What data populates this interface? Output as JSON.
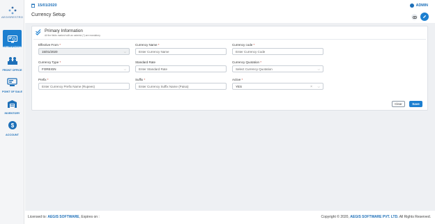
{
  "brand": {
    "name": "AEGISRESTRO"
  },
  "sidebar": {
    "items": [
      {
        "label": "APPLICATION",
        "icon": "application-icon",
        "active": true
      },
      {
        "label": "FRONT OFFICE",
        "icon": "front-office-icon",
        "active": false
      },
      {
        "label": "POINT OF SALE",
        "icon": "point-of-sale-icon",
        "active": false
      },
      {
        "label": "INVENTORY",
        "icon": "inventory-icon",
        "active": false
      },
      {
        "label": "ACCOUNT",
        "icon": "account-icon",
        "active": false
      }
    ]
  },
  "header": {
    "date": "15/01/2020",
    "user": "ADMIN",
    "page_title": "Currency Setup"
  },
  "form": {
    "section_title": "Primary Information",
    "section_note": "All the fields marked with an asterisk (*) are mandatory",
    "effective_from": {
      "label": "Effective From",
      "value": "15/01/2020"
    },
    "currency_name": {
      "label": "Currency Name",
      "placeholder": "Enter Currency Name"
    },
    "currency_code": {
      "label": "Currency code",
      "placeholder": "Enter Currency Code"
    },
    "currency_type": {
      "label": "Currency Type",
      "value": "FOREIGN"
    },
    "standard_rate": {
      "label": "Standard Rate",
      "placeholder": "Enter Standard Rate"
    },
    "currency_quotation": {
      "label": "Currency Quotation",
      "placeholder": "Select Currency Quotation"
    },
    "prefix": {
      "label": "Prefix",
      "placeholder": "Enter Currency Prefix Name (Rupees)"
    },
    "suffix": {
      "label": "Suffix",
      "placeholder": "Enter Currency Suffix Name (Paisa)"
    },
    "active": {
      "label": "Active",
      "value": "YES"
    },
    "required_mark": "*",
    "clear_label": "Clear",
    "save_label": "Save"
  },
  "footer": {
    "licensed_prefix": "Licensed to:",
    "licensee": "AEGIS SOFTWARE",
    "expires": ", Expires on :",
    "copyright_prefix": "Copyright © 2020,",
    "company": "AEGIS SOFTWARE PVT. LTD.",
    "rights": "All Rights Reserved."
  },
  "colors": {
    "accent": "#1c7fd0",
    "brand_text": "#1d6fb8",
    "required": "#c0392b"
  }
}
